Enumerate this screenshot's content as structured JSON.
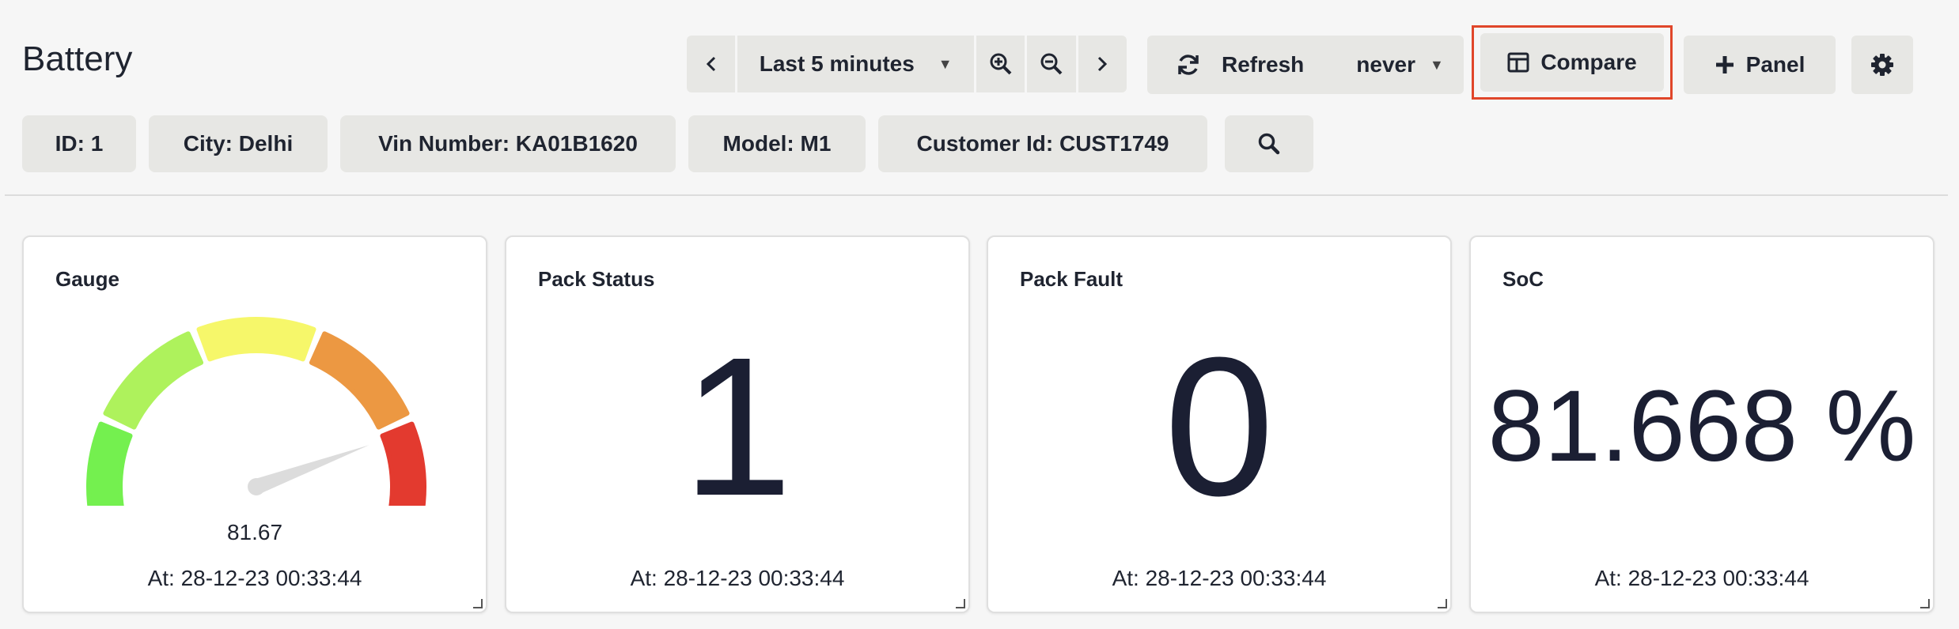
{
  "header": {
    "title": "Battery",
    "time_range": "Last 5 minutes",
    "refresh_label": "Refresh",
    "refresh_interval": "never",
    "compare_label": "Compare",
    "panel_label": "Panel"
  },
  "filters": [
    {
      "label": "ID: 1"
    },
    {
      "label": "City: Delhi"
    },
    {
      "label": "Vin Number: KA01B1620"
    },
    {
      "label": "Model: M1"
    },
    {
      "label": "Customer Id: CUST1749"
    }
  ],
  "panels": {
    "gauge": {
      "title": "Gauge",
      "value": "81.67",
      "value_fraction": 0.8167,
      "timestamp": "At: 28-12-23 00:33:44"
    },
    "pack_status": {
      "title": "Pack Status",
      "value": "1",
      "timestamp": "At: 28-12-23 00:33:44"
    },
    "pack_fault": {
      "title": "Pack Fault",
      "value": "0",
      "timestamp": "At: 28-12-23 00:33:44"
    },
    "soc": {
      "title": "SoC",
      "value": "81.668 %",
      "timestamp": "At: 28-12-23 00:33:44"
    }
  },
  "gauge_colors": [
    "#74f04f",
    "#aef25c",
    "#f6f76a",
    "#ec9842",
    "#e33a2f"
  ],
  "accent": {
    "compare_highlight": "#e0462a"
  }
}
